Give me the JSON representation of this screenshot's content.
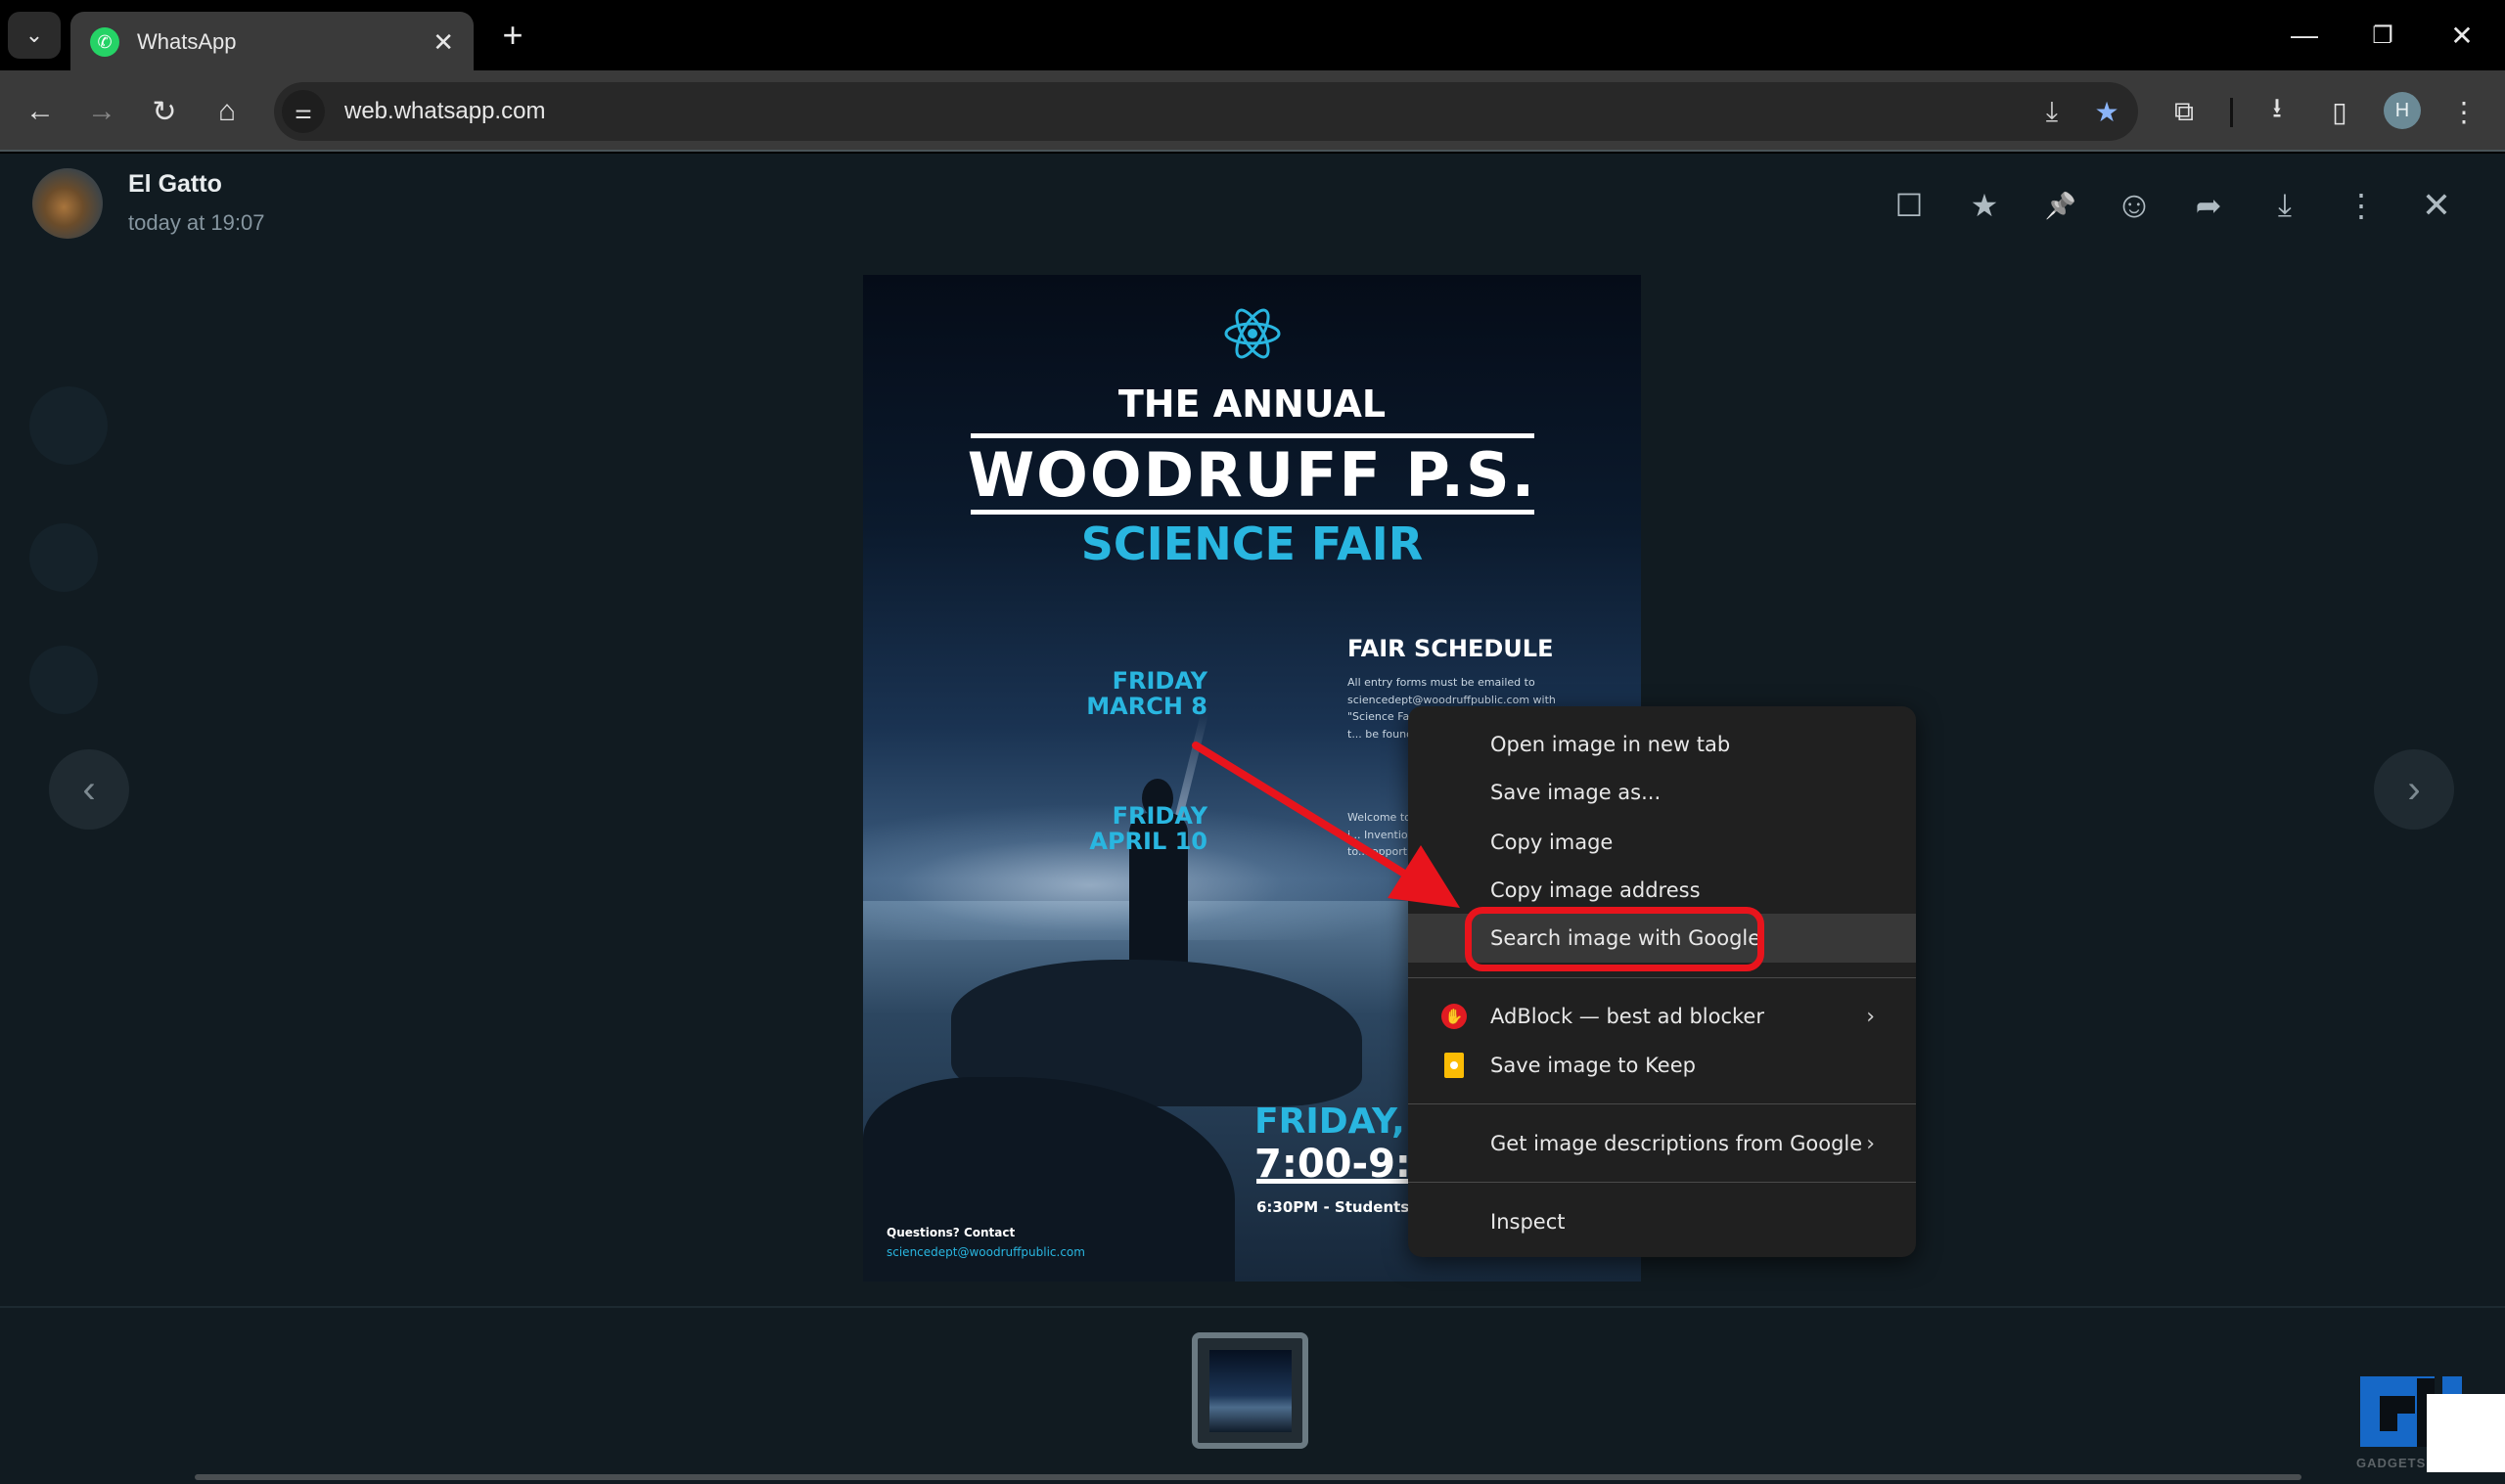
{
  "browser": {
    "tab_search_icon": "chevron-down",
    "tab": {
      "title": "WhatsApp",
      "favicon": "whatsapp-icon",
      "close": "✕"
    },
    "new_tab": "+",
    "window_controls": {
      "minimize": "—",
      "restore": "❐",
      "close": "✕"
    },
    "toolbar": {
      "back": "←",
      "forward": "→",
      "reload": "↻",
      "home": "⌂",
      "url": "web.whatsapp.com",
      "site_info_icon": "⚌",
      "install_icon": "⤓",
      "bookmark_icon": "★",
      "extensions_icon": "⧉",
      "downloads_icon": "⭳",
      "side_panel_icon": "▯",
      "profile_initial": "H",
      "menu_icon": "⋮"
    }
  },
  "viewer": {
    "sender_name": "El Gatto",
    "timestamp": "today at 19:07",
    "header_icons": [
      {
        "name": "reply-icon",
        "glyph": "☐"
      },
      {
        "name": "star-icon",
        "glyph": "★"
      },
      {
        "name": "pin-icon",
        "glyph": "📌"
      },
      {
        "name": "react-icon",
        "glyph": "☺"
      },
      {
        "name": "forward-icon",
        "glyph": "➦"
      },
      {
        "name": "download-icon",
        "glyph": "⤓"
      },
      {
        "name": "more-options-icon",
        "glyph": "⋮"
      },
      {
        "name": "close-icon",
        "glyph": "✕"
      }
    ],
    "prev_arrow": "‹",
    "next_arrow": "›"
  },
  "poster": {
    "annual": "THE ANNUAL",
    "school": "WOODRUFF P.S.",
    "event": "SCIENCE FAIR",
    "schedule_title": "FAIR SCHEDULE",
    "date1": [
      "FRIDAY",
      "MARCH 8"
    ],
    "date1_text": "All entry forms must be emailed to sciencedept@woodruffpublic.com with \"Science Fa... a physical e... submitted t... be found on... Science Dep...",
    "date2": [
      "FRIDAY",
      "APRIL 10"
    ],
    "date2_text": "Welcome to... the scientifi... participate i... Invention... Experienced... feedback to... opportunity...",
    "big_day": "FRIDAY,",
    "big_time": "7:00-9:0",
    "students_line": "6:30PM - Students s",
    "questions": "Questions? Contact",
    "contact_email": "sciencedept@woodruffpublic.com"
  },
  "context_menu": {
    "items": [
      {
        "label": "Open image in new tab"
      },
      {
        "label": "Save image as..."
      },
      {
        "label": "Copy image"
      },
      {
        "label": "Copy image address"
      },
      {
        "label": "Search image with Google",
        "highlighted": true
      },
      {
        "label": "AdBlock — best ad blocker",
        "icon": "adblock-icon",
        "submenu": true
      },
      {
        "label": "Save image to Keep",
        "icon": "keep-icon"
      },
      {
        "label": "Get image descriptions from Google",
        "submenu": true
      },
      {
        "label": "Inspect"
      }
    ],
    "submenu_chevron": "›"
  },
  "annotation": {
    "highlight_color": "#e8141c",
    "target": "Search image with Google"
  },
  "watermark": {
    "text": "GADGETS"
  }
}
